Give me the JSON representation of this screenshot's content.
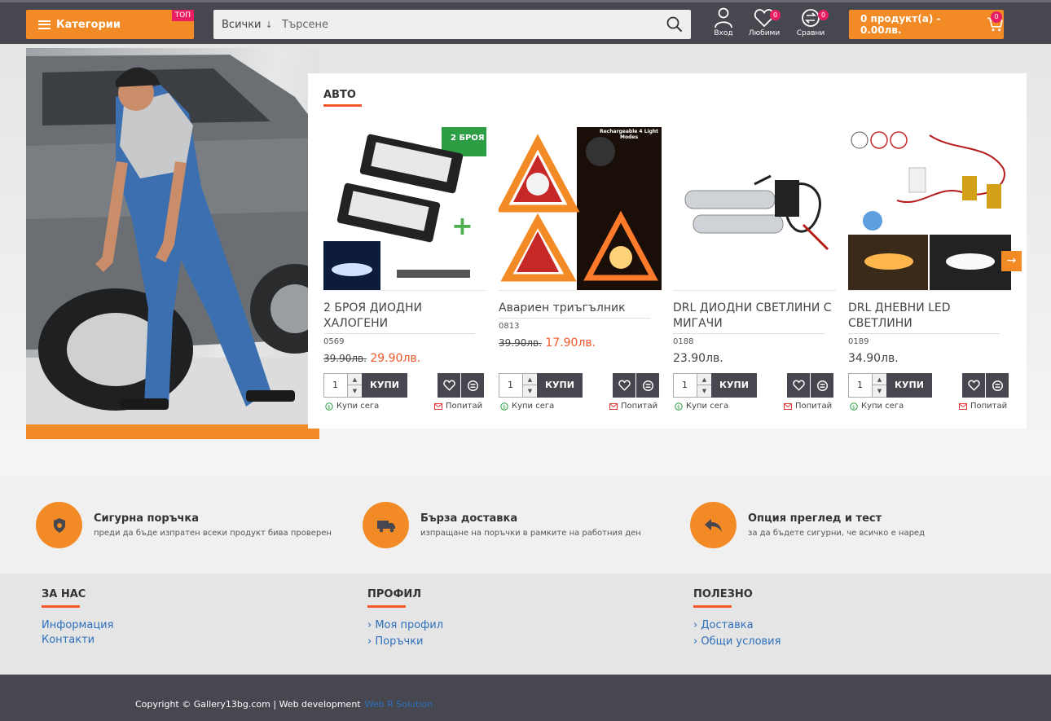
{
  "header": {
    "categories_label": "Категории",
    "top_badge": "ТОП",
    "search_category": "Всички",
    "search_placeholder": "Търсене",
    "login_label": "Вход",
    "favorites_label": "Любими",
    "favorites_count": "0",
    "compare_label": "Сравни",
    "compare_count": "0",
    "cart_label": "0 продукт(а) - 0.00лв.",
    "cart_count": "0"
  },
  "section": {
    "title": "АВТО"
  },
  "products": [
    {
      "name": "2 БРОЯ ДИОДНИ ХАЛОГЕНИ",
      "code": "0569",
      "old_price": "39.90лв.",
      "price": "29.90лв.",
      "badge": "2 БРОЯ"
    },
    {
      "name": "Авариен триъгълник",
      "code": "0813",
      "old_price": "39.90лв.",
      "price": "17.90лв.",
      "badge": "Rechargeable 4 Light Modes"
    },
    {
      "name": "DRL ДИОДНИ СВЕТЛИНИ С МИГАЧИ",
      "code": "0188",
      "old_price": "",
      "price": "23.90лв.",
      "badge": ""
    },
    {
      "name": "DRL ДНЕВНИ LED СВЕТЛИНИ",
      "code": "0189",
      "old_price": "",
      "price": "34.90лв.",
      "badge": ""
    }
  ],
  "product_actions": {
    "qty": "1",
    "buy_label": "КУПИ",
    "buy_now_label": "Купи сега",
    "ask_label": "Попитай"
  },
  "features": [
    {
      "title": "Сигурна поръчка",
      "text": "преди да бъде изпратен всеки продукт бива проверен",
      "icon": "police-badge-icon"
    },
    {
      "title": "Бърза доставка",
      "text": "изпращане на поръчки в рамките на работния ден",
      "icon": "truck-icon"
    },
    {
      "title": "Опция преглед и тест",
      "text": "за да бъдете сигурни, че всичко е наред",
      "icon": "reply-all-icon"
    }
  ],
  "footer": {
    "col1": {
      "title": "ЗА НАС",
      "links": [
        "Информация",
        "Контакти"
      ]
    },
    "col2": {
      "title": "ПРОФИЛ",
      "links": [
        "Моя профил",
        "Поръчки"
      ]
    },
    "col3": {
      "title": "ПОЛЕЗНО",
      "links": [
        "Доставка",
        "Общи условия"
      ]
    },
    "copyright": "Copyright © Gallery13bg.com | Web development",
    "developer": "Web R Solution"
  },
  "colors": {
    "accent": "#f28b25",
    "dark": "#47474f",
    "red": "#f2582a",
    "badge": "#e91e63",
    "link": "#2d6fbd"
  }
}
